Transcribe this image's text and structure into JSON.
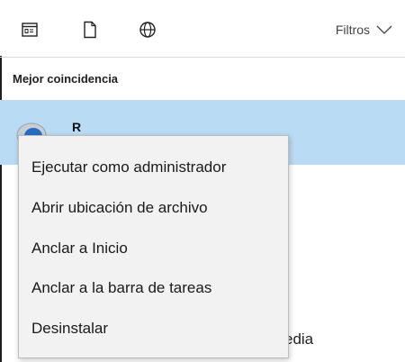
{
  "toolbar": {
    "icons": [
      {
        "name": "apps-icon"
      },
      {
        "name": "document-icon"
      },
      {
        "name": "web-icon"
      }
    ],
    "filters_label": "Filtros",
    "filters_icon": "chevron-down-icon"
  },
  "results": {
    "section_title": "Mejor coincidencia",
    "best_match": {
      "title": "R",
      "icon": "r-app-icon"
    },
    "partial_text": "edia"
  },
  "context_menu": {
    "items": [
      {
        "label": "Ejecutar como administrador"
      },
      {
        "label": "Abrir ubicación de archivo"
      },
      {
        "label": "Anclar a Inicio"
      },
      {
        "label": "Anclar a la barra de tareas"
      },
      {
        "label": "Desinstalar"
      }
    ]
  },
  "colors": {
    "selection_background": "#b9dbf4",
    "menu_background": "#f2f2f2"
  }
}
